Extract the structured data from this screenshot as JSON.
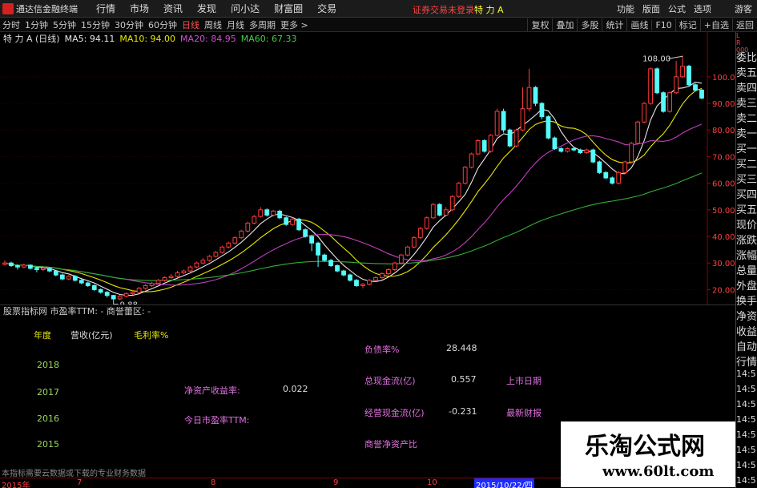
{
  "app": {
    "title": "通达信金融终端",
    "menu": [
      "行情",
      "市场",
      "资讯",
      "发现",
      "问小达",
      "财富圈",
      "交易"
    ],
    "login_status": "证券交易未登录",
    "login_name": "特 力 A",
    "right_menu": [
      "功能",
      "版面",
      "公式",
      "选项"
    ],
    "guest": "游客"
  },
  "toolbar": {
    "periods": [
      "分时",
      "1分钟",
      "5分钟",
      "15分钟",
      "30分钟",
      "60分钟",
      "日线",
      "周线",
      "月线",
      "多周期",
      "更多 >"
    ],
    "active_period": "日线",
    "right_buttons": [
      "复权",
      "叠加",
      "多股",
      "统计",
      "画线",
      "F10",
      "标记",
      "+自选",
      "返回"
    ]
  },
  "chart_header": {
    "stock": "特 力 A (日线)",
    "ma": [
      {
        "label": "MA5: 94.11",
        "color": "#e8e8e8"
      },
      {
        "label": "MA10: 94.00",
        "color": "#e8e800"
      },
      {
        "label": "MA20: 84.95",
        "color": "#d050d0"
      },
      {
        "label": "MA60: 67.33",
        "color": "#40d040"
      }
    ]
  },
  "chart_data": {
    "type": "candlestick",
    "ylim": [
      15,
      112
    ],
    "y_ticks": [
      20.0,
      30.0,
      40.0,
      50.0,
      60.0,
      70.0,
      80.0,
      90.0,
      100.0
    ],
    "candles": [
      [
        29.5,
        30.0,
        31.0,
        29.0
      ],
      [
        30.0,
        29.0,
        30.5,
        28.5
      ],
      [
        29.0,
        28.5,
        29.5,
        27.5
      ],
      [
        28.5,
        29.2,
        29.8,
        28.0
      ],
      [
        29.2,
        28.0,
        29.5,
        27.5
      ],
      [
        28.0,
        27.5,
        28.5,
        26.5
      ],
      [
        27.5,
        28.0,
        28.8,
        27.0
      ],
      [
        28.0,
        27.0,
        28.5,
        26.5
      ],
      [
        27.0,
        25.5,
        27.2,
        25.0
      ],
      [
        25.5,
        24.0,
        26.0,
        23.5
      ],
      [
        24.0,
        25.0,
        25.5,
        23.5
      ],
      [
        25.0,
        23.5,
        25.5,
        23.0
      ],
      [
        23.5,
        22.5,
        24.0,
        22.0
      ],
      [
        22.5,
        21.5,
        23.0,
        21.0
      ],
      [
        21.5,
        20.0,
        22.0,
        19.5
      ],
      [
        20.0,
        19.0,
        20.5,
        18.5
      ],
      [
        19.0,
        17.8,
        19.5,
        17.0
      ],
      [
        17.8,
        16.5,
        18.0,
        14.5
      ],
      [
        16.5,
        17.5,
        18.0,
        16.0
      ],
      [
        17.5,
        18.5,
        19.0,
        17.0
      ],
      [
        18.5,
        19.0,
        19.6,
        18.0
      ],
      [
        19.0,
        20.5,
        21.0,
        18.6
      ],
      [
        20.5,
        21.5,
        22.0,
        20.0
      ],
      [
        21.5,
        22.3,
        23.0,
        21.0
      ],
      [
        22.3,
        23.5,
        24.0,
        22.0
      ],
      [
        23.5,
        24.5,
        25.0,
        23.0
      ],
      [
        24.5,
        25.0,
        25.8,
        24.0
      ],
      [
        25.0,
        26.3,
        27.0,
        24.5
      ],
      [
        26.3,
        27.0,
        27.5,
        25.8
      ],
      [
        27.0,
        28.5,
        29.0,
        26.5
      ],
      [
        28.5,
        30.0,
        30.5,
        28.0
      ],
      [
        30.0,
        31.0,
        31.8,
        29.5
      ],
      [
        31.0,
        32.5,
        33.0,
        30.5
      ],
      [
        32.5,
        34.0,
        34.5,
        32.0
      ],
      [
        34.0,
        36.0,
        36.5,
        33.5
      ],
      [
        36.0,
        37.5,
        38.0,
        35.5
      ],
      [
        37.5,
        39.5,
        40.0,
        37.0
      ],
      [
        39.5,
        42.0,
        42.5,
        39.0
      ],
      [
        42.0,
        45.0,
        45.5,
        41.5
      ],
      [
        45.0,
        47.5,
        48.0,
        44.5
      ],
      [
        47.5,
        50.0,
        51.0,
        47.0
      ],
      [
        50.0,
        48.0,
        50.5,
        47.5
      ],
      [
        48.0,
        49.5,
        50.0,
        47.5
      ],
      [
        49.5,
        47.0,
        50.0,
        46.5
      ],
      [
        47.0,
        44.5,
        47.5,
        44.0
      ],
      [
        44.5,
        46.5,
        47.0,
        44.0
      ],
      [
        46.5,
        42.5,
        47.0,
        42.0
      ],
      [
        42.5,
        40.0,
        43.0,
        39.5
      ],
      [
        40.0,
        37.5,
        40.5,
        34.5
      ],
      [
        37.5,
        33.0,
        38.0,
        28.5
      ],
      [
        33.0,
        31.0,
        33.5,
        30.5
      ],
      [
        31.0,
        29.0,
        31.5,
        28.5
      ],
      [
        29.0,
        27.0,
        29.5,
        26.5
      ],
      [
        27.0,
        25.5,
        27.5,
        25.0
      ],
      [
        25.5,
        23.5,
        26.0,
        23.0
      ],
      [
        23.5,
        21.5,
        24.0,
        21.0
      ],
      [
        21.5,
        22.0,
        22.5,
        20.5
      ],
      [
        22.0,
        23.5,
        24.0,
        21.5
      ],
      [
        23.5,
        24.5,
        25.0,
        23.0
      ],
      [
        24.5,
        26.0,
        26.5,
        24.0
      ],
      [
        26.0,
        27.5,
        28.0,
        25.5
      ],
      [
        27.5,
        30.0,
        30.5,
        27.0
      ],
      [
        30.0,
        33.0,
        33.5,
        29.5
      ],
      [
        33.0,
        36.0,
        36.5,
        32.5
      ],
      [
        36.0,
        39.5,
        40.0,
        35.5
      ],
      [
        39.5,
        43.0,
        43.5,
        39.0
      ],
      [
        43.0,
        47.0,
        47.5,
        42.5
      ],
      [
        47.0,
        52.0,
        52.5,
        46.5
      ],
      [
        52.0,
        48.0,
        52.5,
        47.5
      ],
      [
        48.0,
        50.0,
        51.0,
        47.5
      ],
      [
        50.0,
        55.0,
        55.5,
        49.5
      ],
      [
        55.0,
        60.0,
        60.5,
        54.5
      ],
      [
        60.0,
        66.0,
        66.5,
        59.5
      ],
      [
        66.0,
        71.0,
        71.5,
        65.5
      ],
      [
        71.0,
        76.0,
        76.5,
        70.5
      ],
      [
        76.0,
        72.0,
        76.5,
        71.5
      ],
      [
        72.0,
        78.0,
        78.5,
        71.5
      ],
      [
        78.0,
        87.0,
        88.0,
        77.5
      ],
      [
        87.0,
        80.0,
        88.0,
        79.0
      ],
      [
        80.0,
        74.0,
        80.5,
        73.5
      ],
      [
        74.0,
        80.0,
        80.5,
        73.5
      ],
      [
        80.0,
        88.0,
        96.0,
        79.5
      ],
      [
        88.0,
        96.0,
        103.0,
        87.0
      ],
      [
        96.0,
        90.0,
        96.5,
        89.0
      ],
      [
        90.0,
        85.0,
        90.5,
        84.0
      ],
      [
        85.0,
        77.0,
        85.5,
        76.5
      ],
      [
        77.0,
        73.0,
        77.5,
        72.5
      ],
      [
        73.0,
        72.0,
        73.5,
        71.5
      ],
      [
        72.0,
        73.0,
        73.5,
        71.5
      ],
      [
        73.0,
        72.5,
        73.5,
        72.0
      ],
      [
        72.5,
        71.5,
        73.0,
        71.0
      ],
      [
        71.5,
        72.5,
        73.0,
        71.0
      ],
      [
        72.5,
        68.0,
        73.0,
        67.5
      ],
      [
        68.0,
        64.0,
        68.5,
        63.5
      ],
      [
        64.0,
        62.0,
        64.5,
        61.5
      ],
      [
        62.0,
        60.0,
        62.5,
        59.5
      ],
      [
        60.0,
        64.0,
        64.5,
        59.5
      ],
      [
        64.0,
        68.0,
        68.5,
        63.5
      ],
      [
        68.0,
        75.0,
        75.5,
        67.5
      ],
      [
        75.0,
        83.0,
        83.5,
        74.5
      ],
      [
        83.0,
        90.0,
        90.5,
        82.5
      ],
      [
        90.0,
        103.0,
        103.5,
        89.5
      ],
      [
        103.0,
        94.0,
        103.5,
        93.5
      ],
      [
        94.0,
        87.0,
        94.5,
        86.5
      ],
      [
        87.0,
        94.0,
        94.5,
        86.5
      ],
      [
        94.0,
        100.0,
        106.0,
        93.5
      ],
      [
        100.0,
        104.0,
        108.0,
        99.5
      ],
      [
        104.0,
        97.0,
        104.5,
        96.5
      ],
      [
        97.0,
        95.0,
        97.5,
        94.5
      ],
      [
        95.0,
        92.0,
        95.5,
        91.5
      ]
    ],
    "annotations": {
      "high": "108.00",
      "low": "9.88"
    }
  },
  "side_panel": {
    "top": [
      "L",
      "R",
      "000"
    ],
    "items": [
      "委比",
      "卖五",
      "卖四",
      "卖三",
      "卖二",
      "卖一",
      "买一",
      "买二",
      "买三",
      "买四",
      "买五",
      "现价",
      "涨跌",
      "涨幅",
      "总量",
      "外盘",
      "换手",
      "净资",
      "收益"
    ],
    "auto_label": "自动",
    "quote_label": "行情",
    "times": [
      "14:5",
      "14:5",
      "14:5",
      "14:5",
      "14:5",
      "14:5",
      "14:5",
      "14:5",
      "14:5"
    ]
  },
  "lower_panel": {
    "header": "股票指标网   市盈率TTM: -   商誉蕾区: -",
    "col_year": "年度",
    "col_revenue": "营收(亿元)",
    "col_margin": "毛利率%",
    "years": [
      "2018",
      "2017",
      "2016",
      "2015"
    ],
    "roe_label": "净资产收益率:",
    "roe_value": "0.022",
    "pe_label": "今日市盈率TTM:",
    "debt_label": "负债率%",
    "debt_value": "28.448",
    "cash_label": "总现金流(亿)",
    "cash_value": "0.557",
    "opcash_label": "经营现金流(亿)",
    "opcash_value": "-0.231",
    "bvps_label": "商誉净资产比",
    "listing_label": "上市日期",
    "latest_label": "最新财报",
    "footer": "本指标需要云数据或下载的专业财务数据"
  },
  "time_axis": {
    "labels": [
      {
        "text": "2015年",
        "pos": 2
      },
      {
        "text": "7",
        "pos": 96
      },
      {
        "text": "8",
        "pos": 263
      },
      {
        "text": "9",
        "pos": 416
      },
      {
        "text": "10",
        "pos": 533
      }
    ],
    "cursor": "2015/10/22/四"
  },
  "watermark": {
    "title": "乐淘公式网",
    "url": "www.60lt.com"
  }
}
